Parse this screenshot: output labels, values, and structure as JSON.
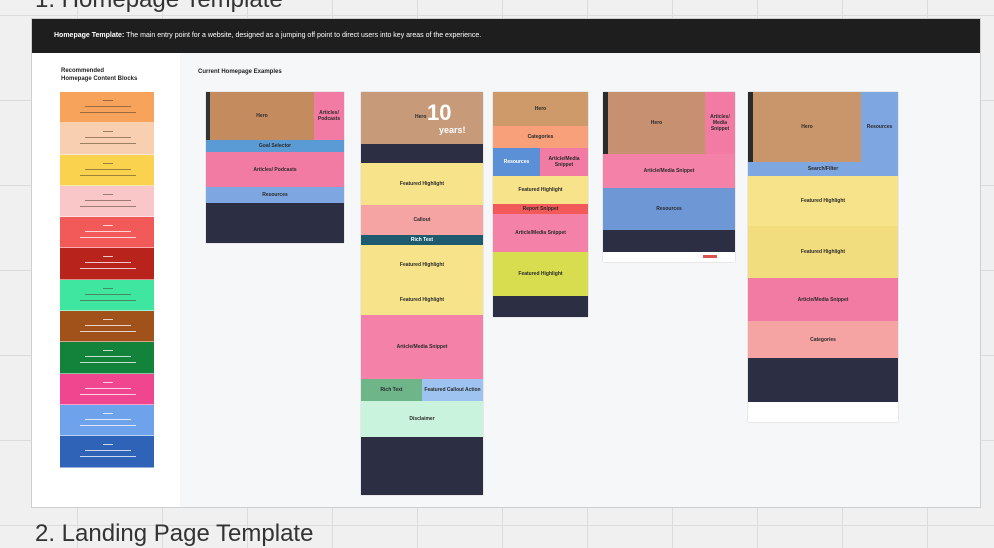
{
  "headings": {
    "top": "1. Homepage Template",
    "bottom": "2. Landing Page Template"
  },
  "banner": {
    "title": "Homepage Template:",
    "description": "The main entry point for a website, designed as a jumping off point to direct users into key areas of the experience."
  },
  "left_panel": {
    "title_line1": "Recommended",
    "title_line2": "Homepage Content Blocks",
    "swatch_colors": [
      "#f7a35c",
      "#f8cfb0",
      "#fbd24e",
      "#f9c7c7",
      "#f25a5a",
      "#b8241c",
      "#3fe6a0",
      "#a0521a",
      "#13823b",
      "#f0468f",
      "#6ea3ec",
      "#2f63b8"
    ]
  },
  "examples_title": "Current Homepage Examples",
  "examples": {
    "ex1": {
      "hero": "Hero",
      "articles": "Articles/ Podcasts",
      "goal": "Goal Selector",
      "articles2": "Articles/ Podcasts",
      "resources": "Resources"
    },
    "ex2": {
      "hero": "Hero",
      "big_text": "10",
      "big_sub": "years!",
      "featured1": "Featured Highlight",
      "callout": "Callout",
      "richtext": "Rich Text",
      "featured2": "Featured Highlight",
      "featured3": "Featured Highlight",
      "snippet": "Article/Media Snippet",
      "richtext2": "Rich Text",
      "featured_callout": "Featured Callout Action",
      "disclaimer": "Disclaimer"
    },
    "ex3": {
      "hero": "Hero",
      "categories": "Categories",
      "resources": "Resources",
      "snippet": "Article/Media Snippet",
      "featured1": "Featured Highlight",
      "report": "Report Snippet",
      "snippet2": "Article/Media Snippet",
      "featured2": "Featured Highlight"
    },
    "ex4": {
      "hero": "Hero",
      "articles": "Articles/ Media Snippet",
      "snippet": "Article/Media Snippet",
      "resources": "Resources"
    },
    "ex5": {
      "hero": "Hero",
      "resources": "Resources",
      "search": "Search/Filter",
      "featured1": "Featured Highlight",
      "featured2": "Featured Highlight",
      "snippet": "Article/Media Snippet",
      "categories": "Categories"
    }
  }
}
